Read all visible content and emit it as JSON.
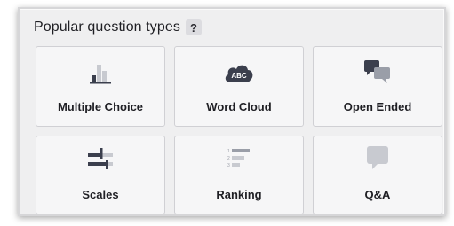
{
  "panel": {
    "title": "Popular question types",
    "help_label": "?"
  },
  "cards": [
    {
      "label": "Multiple Choice",
      "icon": "bar-chart-icon"
    },
    {
      "label": "Word Cloud",
      "icon": "word-cloud-icon",
      "icon_text": "ABC"
    },
    {
      "label": "Open Ended",
      "icon": "speech-bubbles-icon"
    },
    {
      "label": "Scales",
      "icon": "sliders-icon"
    },
    {
      "label": "Ranking",
      "icon": "ranking-icon",
      "icon_numbers": [
        "1",
        "2",
        "3"
      ]
    },
    {
      "label": "Q&A",
      "icon": "question-bubble-icon"
    }
  ],
  "colors": {
    "icon_dark": "#3b3f4d",
    "icon_light": "#c8cad0",
    "icon_mid": "#9a9ea8"
  }
}
